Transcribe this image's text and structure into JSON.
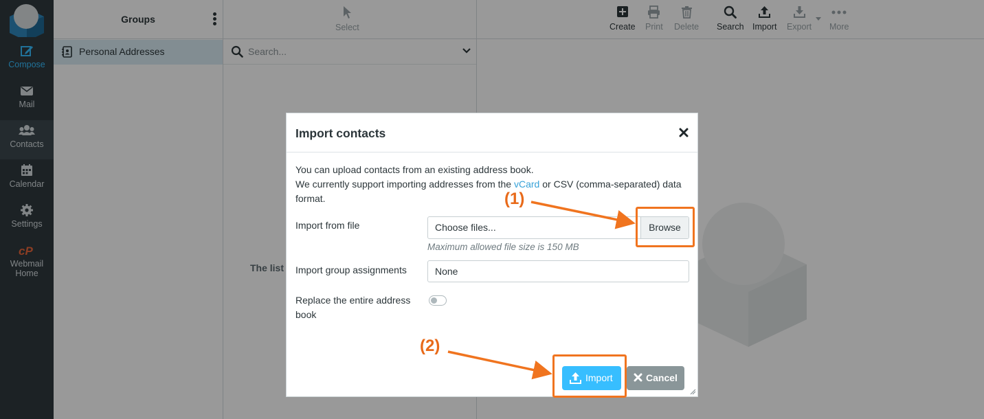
{
  "nav": {
    "items": [
      {
        "label": "Compose",
        "icon": "compose-icon"
      },
      {
        "label": "Mail",
        "icon": "mail-icon"
      },
      {
        "label": "Contacts",
        "icon": "contacts-icon"
      },
      {
        "label": "Calendar",
        "icon": "calendar-icon"
      },
      {
        "label": "Settings",
        "icon": "gear-icon"
      },
      {
        "label_line1": "Webmail",
        "label_line2": "Home",
        "icon": "cpanel-icon"
      }
    ]
  },
  "groups": {
    "title": "Groups",
    "items": [
      {
        "label": "Personal Addresses"
      }
    ]
  },
  "list": {
    "select_label": "Select",
    "search_placeholder": "Search...",
    "empty_message": "The list"
  },
  "toolbar": {
    "create": "Create",
    "print": "Print",
    "delete": "Delete",
    "search": "Search",
    "import": "Import",
    "export": "Export",
    "more": "More"
  },
  "dialog": {
    "title": "Import contacts",
    "intro_line1": "You can upload contacts from an existing address book.",
    "intro_line2_prefix": "We currently support importing addresses from the ",
    "intro_link": "vCard",
    "intro_line2_suffix": " or CSV (comma-separated) data",
    "intro_line3": "format.",
    "file_label": "Import from file",
    "file_placeholder": "Choose files...",
    "browse_label": "Browse",
    "hint": "Maximum allowed file size is 150 MB",
    "group_label": "Import group assignments",
    "group_value": "None",
    "replace_label_line1": "Replace the entire address",
    "replace_label_line2": "book",
    "replace_enabled": false,
    "import_button": "Import",
    "cancel_button": "Cancel"
  },
  "annotations": {
    "step1": "(1)",
    "step2": "(2)",
    "color": "#f0741f"
  }
}
